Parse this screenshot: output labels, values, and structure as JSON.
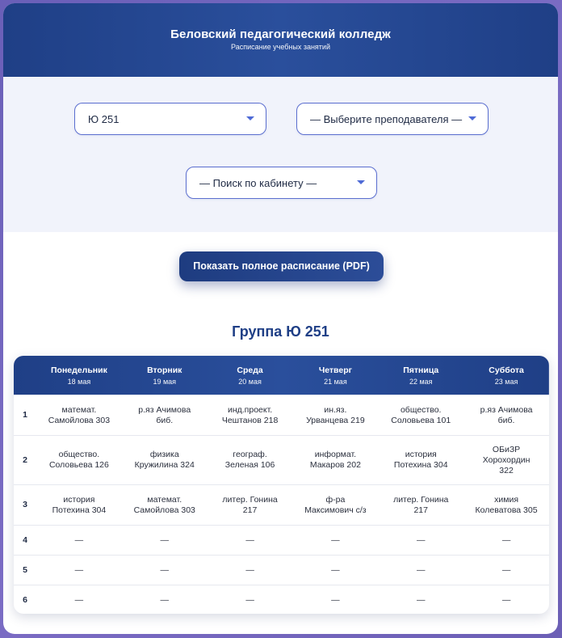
{
  "header": {
    "title": "Беловский педагогический колледж",
    "subtitle": "Расписание учебных занятий"
  },
  "filters": {
    "group_value": "Ю 251",
    "teacher_value": "— Выберите преподавателя —",
    "room_value": "— Поиск по кабинету —"
  },
  "pdf_button": "Показать полное расписание (PDF)",
  "group_title": "Группа Ю 251",
  "colors": {
    "primary": "#1f3f86",
    "accent": "#4e6ad6",
    "background": "#6a5fb8"
  },
  "table": {
    "days": [
      {
        "name": "Понедельник",
        "date": "18 мая"
      },
      {
        "name": "Вторник",
        "date": "19 мая"
      },
      {
        "name": "Среда",
        "date": "20 мая"
      },
      {
        "name": "Четверг",
        "date": "21 мая"
      },
      {
        "name": "Пятница",
        "date": "22 мая"
      },
      {
        "name": "Суббота",
        "date": "23 мая"
      }
    ],
    "rows": [
      {
        "num": "1",
        "cells": [
          {
            "l1": "математ.",
            "l2": "Самойлова 303"
          },
          {
            "l1": "р.яз Ачимова",
            "l2": "биб."
          },
          {
            "l1": "инд.проект.",
            "l2": "Чештанов 218"
          },
          {
            "l1": "ин.яз.",
            "l2": "Урванцева 219"
          },
          {
            "l1": "общество.",
            "l2": "Соловьева 101"
          },
          {
            "l1": "р.яз Ачимова",
            "l2": "биб."
          }
        ]
      },
      {
        "num": "2",
        "cells": [
          {
            "l1": "общество.",
            "l2": "Соловьева 126"
          },
          {
            "l1": "физика",
            "l2": "Кружилина 324"
          },
          {
            "l1": "географ.",
            "l2": "Зеленая 106"
          },
          {
            "l1": "информат.",
            "l2": "Макаров 202"
          },
          {
            "l1": "история",
            "l2": "Потехина 304"
          },
          {
            "l1": "ОБиЗР",
            "l2": "Хорохордин",
            "l3": "322"
          }
        ]
      },
      {
        "num": "3",
        "cells": [
          {
            "l1": "история",
            "l2": "Потехина 304"
          },
          {
            "l1": "математ.",
            "l2": "Самойлова 303"
          },
          {
            "l1": "литер. Гонина",
            "l2": "217"
          },
          {
            "l1": "ф-ра",
            "l2": "Максимович с/з"
          },
          {
            "l1": "литер. Гонина",
            "l2": "217"
          },
          {
            "l1": "химия",
            "l2": "Колеватова 305"
          }
        ]
      },
      {
        "num": "4",
        "cells": [
          {
            "l1": "—"
          },
          {
            "l1": "—"
          },
          {
            "l1": "—"
          },
          {
            "l1": "—"
          },
          {
            "l1": "—"
          },
          {
            "l1": "—"
          }
        ]
      },
      {
        "num": "5",
        "cells": [
          {
            "l1": "—"
          },
          {
            "l1": "—"
          },
          {
            "l1": "—"
          },
          {
            "l1": "—"
          },
          {
            "l1": "—"
          },
          {
            "l1": "—"
          }
        ]
      },
      {
        "num": "6",
        "cells": [
          {
            "l1": "—"
          },
          {
            "l1": "—"
          },
          {
            "l1": "—"
          },
          {
            "l1": "—"
          },
          {
            "l1": "—"
          },
          {
            "l1": "—"
          }
        ]
      }
    ]
  }
}
